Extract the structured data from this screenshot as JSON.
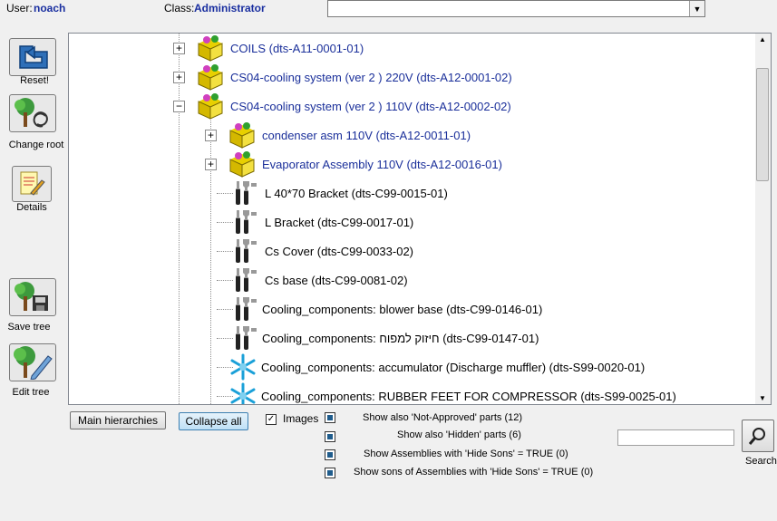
{
  "header": {
    "user_label": "User:",
    "user_value": "noach",
    "class_label": "Class:",
    "class_value": "Administrator",
    "combo_value": ""
  },
  "toolbar": [
    {
      "label": "Reset!",
      "icon": "back-arrow-icon"
    },
    {
      "label": "Change root",
      "icon": "tree-refresh-icon"
    },
    {
      "label": "Details",
      "icon": "document-pencil-icon"
    },
    {
      "label": "Save tree",
      "icon": "tree-save-icon"
    },
    {
      "label": "Edit tree",
      "icon": "tree-edit-icon"
    }
  ],
  "tree": {
    "rows": [
      {
        "label": "COILS  (dts-A11-0001-01)",
        "type": "assembly",
        "expander": "+"
      },
      {
        "label": "CS04-cooling system (ver 2 ) 220V  (dts-A12-0001-02)",
        "type": "assembly",
        "expander": "+"
      },
      {
        "label": "CS04-cooling system (ver 2 ) 110V  (dts-A12-0002-02)",
        "type": "assembly",
        "expander": "−"
      },
      {
        "label": "condenser asm 110V  (dts-A12-0011-01)",
        "type": "assembly",
        "expander": "+"
      },
      {
        "label": "Evaporator Assembly 110V  (dts-A12-0016-01)",
        "type": "assembly",
        "expander": "+"
      },
      {
        "label": "L 40*70 Bracket  (dts-C99-0015-01)",
        "type": "part-tools"
      },
      {
        "label": "L Bracket  (dts-C99-0017-01)",
        "type": "part-tools"
      },
      {
        "label": "Cs Cover  (dts-C99-0033-02)",
        "type": "part-tools"
      },
      {
        "label": "Cs base  (dts-C99-0081-02)",
        "type": "part-tools"
      },
      {
        "label": "Cooling_components:  blower base  (dts-C99-0146-01)",
        "type": "part-tools"
      },
      {
        "label": "Cooling_components:  חיזוק למפוח  (dts-C99-0147-01)",
        "type": "part-tools"
      },
      {
        "label": "Cooling_components:  accumulator (Discharge muffler)  (dts-S99-0020-01)",
        "type": "part-snow"
      },
      {
        "label": "Cooling_components:  RUBBER FEET FOR COMPRESSOR  (dts-S99-0025-01)",
        "type": "part-snow"
      }
    ]
  },
  "bottom": {
    "main_hierarchies": "Main hierarchies",
    "collapse_all": "Collapse all",
    "images_label": "Images",
    "images_checked": true,
    "options": [
      "Show also 'Not-Approved' parts (12)",
      "Show also 'Hidden' parts (6)",
      "Show Assemblies with 'Hide Sons' = TRUE (0)",
      "Show sons of Assemblies with 'Hide Sons' = TRUE (0)"
    ],
    "search_value": "",
    "search_label": "Search"
  },
  "colors": {
    "assembly_text": "#1a2f9a",
    "header_value": "#1a2fa0"
  }
}
